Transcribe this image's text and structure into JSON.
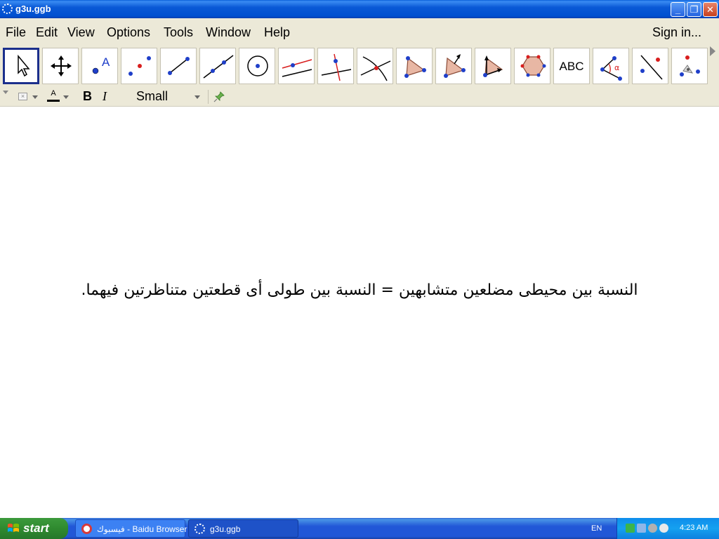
{
  "window": {
    "title": "g3u.ggb",
    "controls": {
      "minimize": "_",
      "restore": "❐",
      "close": "✕"
    }
  },
  "menubar": {
    "items": [
      "File",
      "Edit",
      "View",
      "Options",
      "Tools",
      "Window",
      "Help"
    ],
    "sign_in": "Sign in..."
  },
  "toolbar": {
    "tools": [
      {
        "name": "move-tool",
        "icon": "arrow-pointer-icon",
        "selected": true
      },
      {
        "name": "move-graphics-view-tool",
        "icon": "four-arrows-icon"
      },
      {
        "name": "new-point-tool",
        "icon": "point-A-icon"
      },
      {
        "name": "midpoint-tool",
        "icon": "midpoint-icon"
      },
      {
        "name": "segment-tool",
        "icon": "segment-icon"
      },
      {
        "name": "line-tool",
        "icon": "line-through-points-icon"
      },
      {
        "name": "circle-tool",
        "icon": "circle-center-point-icon"
      },
      {
        "name": "parallel-line-tool",
        "icon": "parallel-line-icon"
      },
      {
        "name": "perpendicular-line-tool",
        "icon": "perpendicular-line-icon"
      },
      {
        "name": "intersect-tool",
        "icon": "intersect-icon"
      },
      {
        "name": "polygon-tool",
        "icon": "polygon-icon"
      },
      {
        "name": "reflect-tool",
        "icon": "polygon-vector-icon"
      },
      {
        "name": "vector-tool",
        "icon": "vector-polygon-icon"
      },
      {
        "name": "regular-polygon-tool",
        "icon": "regular-polygon-icon"
      },
      {
        "name": "text-tool",
        "icon": "text-abc-icon",
        "label": "ABC"
      },
      {
        "name": "angle-tool",
        "icon": "angle-icon"
      },
      {
        "name": "line-reflect-tool",
        "icon": "reflect-line-icon"
      },
      {
        "name": "rotate-tool",
        "icon": "rotate-icon"
      }
    ]
  },
  "stylebar": {
    "bold": "B",
    "italic": "I",
    "text_size": "Small"
  },
  "canvas": {
    "text": "النسبة بين محيطى مضلعين متشابهين = النسبة بين طولى أى قطعتين متناظرتين فيهما."
  },
  "taskbar": {
    "start_label": "start",
    "tasks": [
      {
        "label": "فيسبوك - Baidu Browser",
        "active": false
      },
      {
        "label": "g3u.ggb",
        "active": true
      }
    ],
    "language": "EN",
    "clock": "4:23 AM"
  },
  "colors": {
    "titlebar_blue": "#0050d0",
    "point_blue": "#1f3fc9",
    "accent_red": "#d81e1e",
    "polygon_fill": "#e8b7a4",
    "selected_border": "#1b2f8c"
  }
}
